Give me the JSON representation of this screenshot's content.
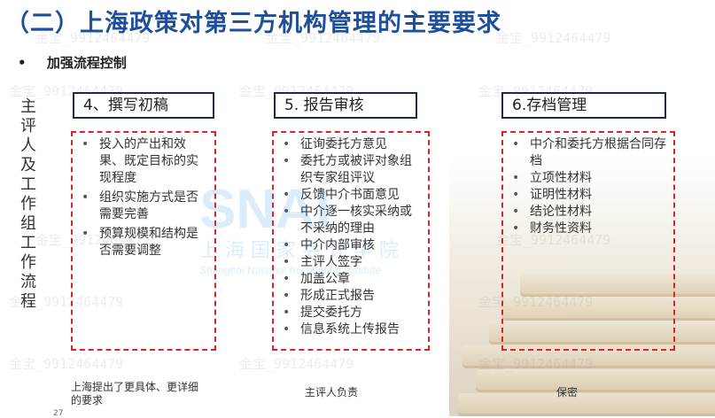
{
  "header": {
    "title": "（二）上海政策对第三方机构管理的主要要求"
  },
  "section": {
    "bullet": "•",
    "label": "加强流程控制"
  },
  "side_label": "主评人及工作组工作流程",
  "columns": [
    {
      "header": "4、撰写初稿",
      "items": [
        "投入的产出和效果、既定目标的实现程度",
        "组织实施方式是否需要完善",
        "预算规模和结构是否需要调整"
      ],
      "note": "上海提出了更具体、更详细的要求"
    },
    {
      "header": "5. 报告审核",
      "items": [
        "征询委托方意见",
        "委托方或被评对象组织专家组评议",
        "反馈中介书面意见",
        "中介逐一核实采纳或不采纳的理由",
        "中介内部审核",
        "主评人签字",
        "加盖公章",
        "形成正式报告",
        "提交委托方",
        "信息系统上传报告"
      ],
      "note": "主评人负责"
    },
    {
      "header": "6.存档管理",
      "items": [
        "中介和委托方根据合同存档",
        "立项性材料",
        "证明性材料",
        "结论性材料",
        "财务性资料"
      ],
      "note": "保密"
    }
  ],
  "page_number": "27",
  "watermarks": {
    "repeat_text": "金宝_9912464479",
    "logo_text": "SNAI",
    "logo_cn": "上 海 国 家 会 计 学 院",
    "logo_en": "Shanghai National Accounting Institute"
  },
  "colors": {
    "title": "#1f4e9a",
    "dashed_border": "#d9232d",
    "header_border": "#1a2a4a"
  }
}
